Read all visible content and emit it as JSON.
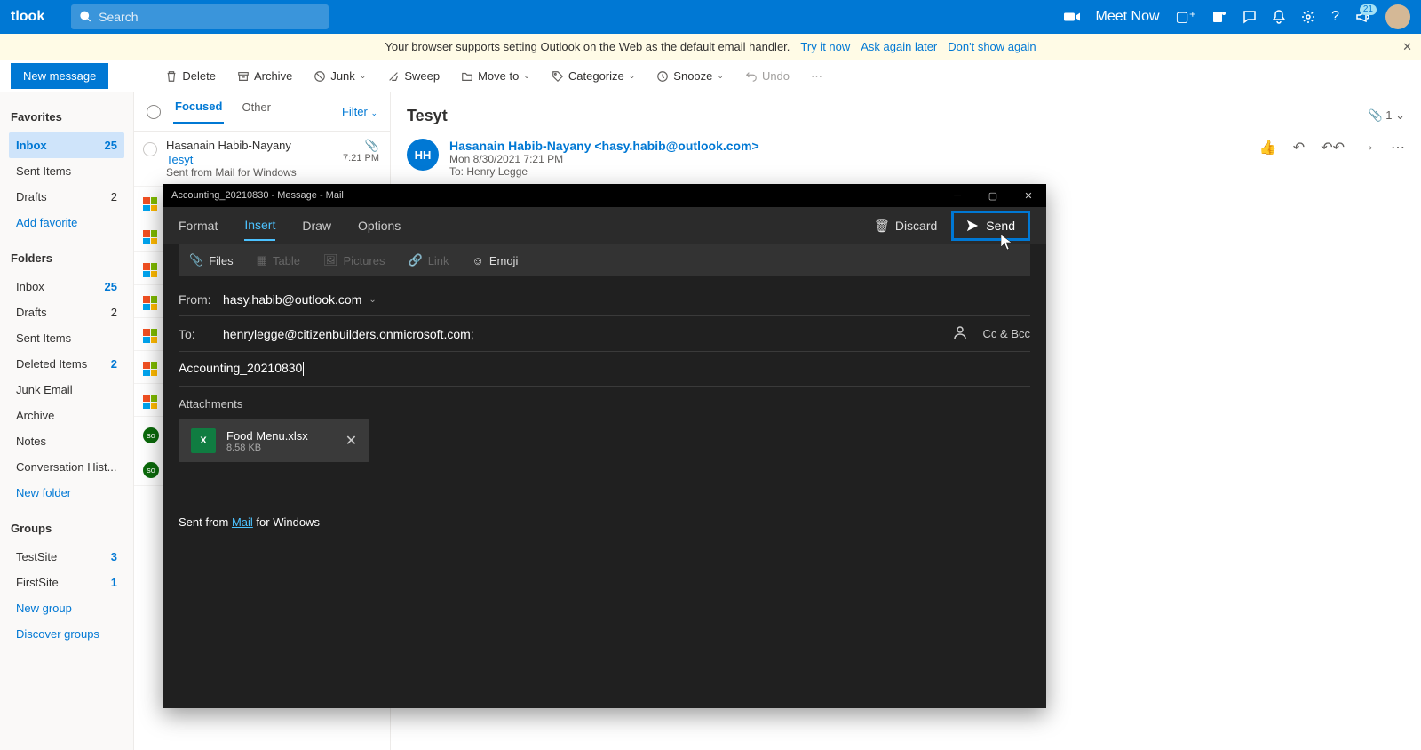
{
  "header": {
    "brand": "tlook",
    "search_placeholder": "Search",
    "meet_now": "Meet Now",
    "badge": "21"
  },
  "notif": {
    "text": "Your browser supports setting Outlook on the Web as the default email handler.",
    "try": "Try it now",
    "ask": "Ask again later",
    "dont": "Don't show again"
  },
  "toolbar": {
    "new_message": "New message",
    "delete": "Delete",
    "archive": "Archive",
    "junk": "Junk",
    "sweep": "Sweep",
    "move": "Move to",
    "categorize": "Categorize",
    "snooze": "Snooze",
    "undo": "Undo"
  },
  "sidebar": {
    "favorites": "Favorites",
    "folders": "Folders",
    "groups": "Groups",
    "fav": [
      {
        "label": "Inbox",
        "count": "25"
      },
      {
        "label": "Sent Items",
        "count": ""
      },
      {
        "label": "Drafts",
        "count": "2"
      }
    ],
    "add_fav": "Add favorite",
    "fol": [
      {
        "label": "Inbox",
        "count": "25"
      },
      {
        "label": "Drafts",
        "count": "2"
      },
      {
        "label": "Sent Items",
        "count": ""
      },
      {
        "label": "Deleted Items",
        "count": "2"
      },
      {
        "label": "Junk Email",
        "count": ""
      },
      {
        "label": "Archive",
        "count": ""
      },
      {
        "label": "Notes",
        "count": ""
      },
      {
        "label": "Conversation Hist...",
        "count": ""
      }
    ],
    "new_folder": "New folder",
    "grp": [
      {
        "label": "TestSite",
        "count": "3"
      },
      {
        "label": "FirstSite",
        "count": "1"
      }
    ],
    "new_group": "New group",
    "discover": "Discover groups"
  },
  "msglist": {
    "focused": "Focused",
    "other": "Other",
    "filter": "Filter",
    "first": {
      "from": "Hasanain Habib-Nayany",
      "subject": "Tesyt",
      "preview": "Sent from Mail for Windows",
      "time": "7:21 PM"
    }
  },
  "reading": {
    "subject": "Tesyt",
    "att_count": "1",
    "from": "Hasanain Habib-Nayany <hasy.habib@outlook.com>",
    "date": "Mon 8/30/2021 7:21 PM",
    "to_label": "To:",
    "to": "Henry Legge",
    "initials": "HH"
  },
  "mail": {
    "title": "Accounting_20210830 - Message - Mail",
    "tabs": {
      "format": "Format",
      "insert": "Insert",
      "draw": "Draw",
      "options": "Options"
    },
    "discard": "Discard",
    "send": "Send",
    "insert_bar": {
      "files": "Files",
      "table": "Table",
      "pictures": "Pictures",
      "link": "Link",
      "emoji": "Emoji"
    },
    "from_label": "From:",
    "from": "hasy.habib@outlook.com",
    "to_label": "To:",
    "to": "henrylegge@citizenbuilders.onmicrosoft.com;",
    "ccbcc": "Cc & Bcc",
    "subject": "Accounting_20210830",
    "attachments": "Attachments",
    "att_name": "Food Menu.xlsx",
    "att_size": "8.58 KB",
    "sig_pre": "Sent from ",
    "sig_link": "Mail",
    "sig_post": " for Windows"
  }
}
